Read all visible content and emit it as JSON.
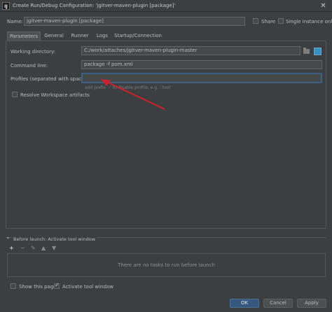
{
  "window": {
    "title": "Create Run/Debug Configuration: 'jgitver-maven-plugin [package]'",
    "app_icon_text": "IJ",
    "close_glyph": "✕"
  },
  "header": {
    "name_label": "Name:",
    "name_value": "jgitver-maven-plugin [package]",
    "share_label": "Share",
    "single_instance_label": "Single instance only"
  },
  "tabs": [
    "Parameters",
    "General",
    "Runner",
    "Logs",
    "Startup/Connection"
  ],
  "parameters": {
    "working_directory_label": "Working directory:",
    "working_directory_value": "C:/work/attaches/jgitver-maven-plugin-master",
    "command_line_label": "Command line:",
    "command_line_value": "package -f pom.xml",
    "profiles_label": "Profiles (separated with space):",
    "profiles_value": "",
    "profiles_hint": "add prefix '-' to disable profile, e.g. '-test'",
    "resolve_label": "Resolve Workspace artifacts"
  },
  "before_launch": {
    "title": "Before launch: Activate tool window",
    "toolbar": [
      "+",
      "−",
      "✎",
      "▲",
      "▼"
    ],
    "empty_message": "There are no tasks to run before launch"
  },
  "footer": {
    "show_page_label": "Show this page",
    "activate_tool_label": "Activate tool window",
    "ok_label": "OK",
    "cancel_label": "Cancel",
    "apply_label": "Apply"
  },
  "colors": {
    "accent": "#365880",
    "arrow": "#d0202a",
    "background": "#3c3f41"
  }
}
